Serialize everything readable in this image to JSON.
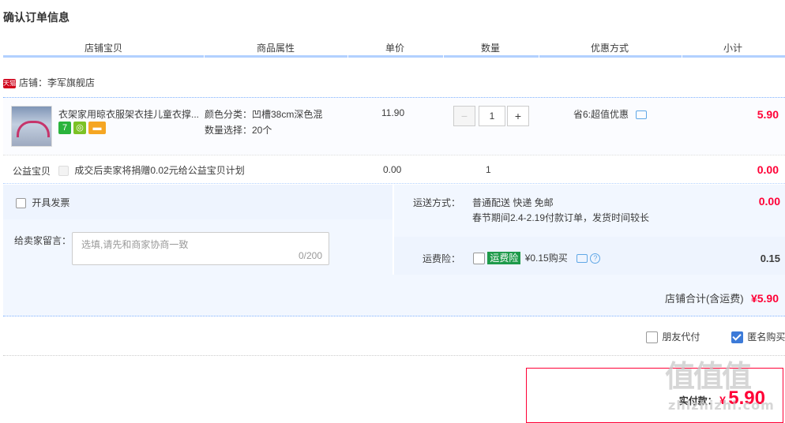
{
  "title": "确认订单信息",
  "table_headers": [
    "店铺宝贝",
    "商品属性",
    "单价",
    "数量",
    "优惠方式",
    "小计"
  ],
  "shop": {
    "badge": "天猫",
    "label": "店铺：李军旗舰店"
  },
  "item": {
    "name": "衣架家用晾衣服架衣挂儿童衣撑...",
    "attr_color": "颜色分类：凹槽38cm深色混",
    "attr_qty": "数量选择：20个",
    "badge_seven": "7",
    "price": "11.90",
    "qty_minus": "−",
    "qty_value": "1",
    "qty_plus": "+",
    "discount": "省6:超值优惠",
    "subtotal": "5.90"
  },
  "charity": {
    "label": "公益宝贝",
    "text": "成交后卖家将捐赠0.02元给公益宝贝计划",
    "price": "0.00",
    "qty": "1",
    "subtotal": "0.00"
  },
  "invoice": {
    "label": "开具发票"
  },
  "message": {
    "label": "给卖家留言：",
    "placeholder": "选填,请先和商家协商一致",
    "counter": "0/200"
  },
  "shipping": {
    "label": "运送方式：",
    "method": "普通配送 快递 免邮",
    "note": "春节期间2.4-2.19付款订单，发货时间较长",
    "price": "0.00"
  },
  "insurance": {
    "label": "运费险：",
    "badge": "运费险",
    "text": "¥0.15购买",
    "price": "0.15"
  },
  "shop_total": {
    "label": "店铺合计(含运费)",
    "value": "¥5.90"
  },
  "options": {
    "friend_pay": "朋友代付",
    "anonymous": "匿名购买"
  },
  "pay": {
    "label": "实付款：",
    "currency": "¥",
    "value": "5.90"
  },
  "watermark": {
    "main": "值值值",
    "sub": "zhizhizhi.com"
  },
  "colors": {
    "accent_red": "#ff0036",
    "header_line": "#b2d1ff",
    "panel_bg": "#f2f7ff"
  }
}
